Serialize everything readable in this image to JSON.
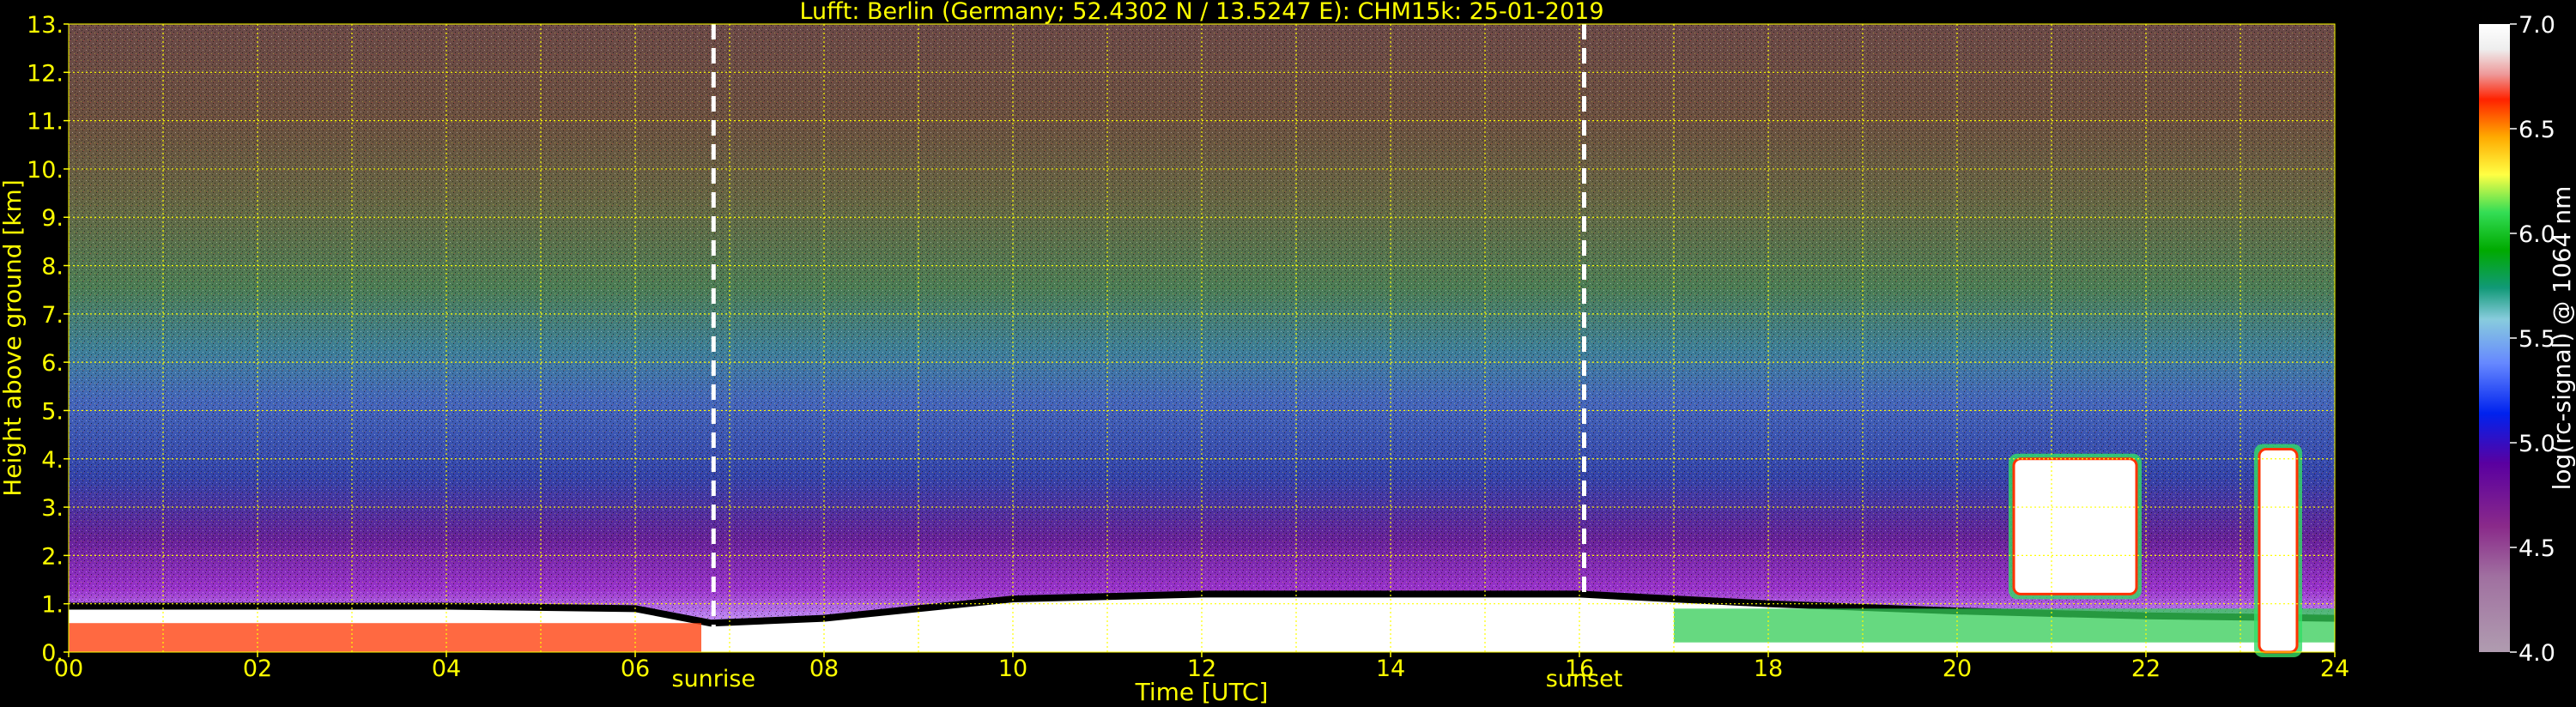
{
  "chart_data": {
    "type": "heatmap",
    "title": "Lufft: Berlin (Germany; 52.4302 N / 13.5247 E):    CHM15k: 25-01-2019",
    "xlabel": "Time [UTC]",
    "ylabel": "Height above ground [km]",
    "xlim": [
      0,
      24
    ],
    "ylim": [
      0,
      13
    ],
    "x_ticks": [
      "00",
      "02",
      "04",
      "06",
      "08",
      "10",
      "12",
      "14",
      "16",
      "18",
      "20",
      "22",
      "24"
    ],
    "y_ticks": [
      "0.",
      "1.",
      "2.",
      "3.",
      "4.",
      "5.",
      "6.",
      "7.",
      "8.",
      "9.",
      "10.",
      "11.",
      "12.",
      "13."
    ],
    "grid": true,
    "markers": [
      {
        "label": "sunrise",
        "x": 6.83
      },
      {
        "label": "sunset",
        "x": 16.05
      }
    ],
    "colorbar": {
      "label": "log(rc-signal) @ 1064 nm",
      "range": [
        4.0,
        7.0
      ],
      "ticks": [
        "4.0",
        "4.5",
        "5.0",
        "5.5",
        "6.0",
        "6.5",
        "7.0"
      ]
    },
    "features": [
      {
        "name": "boundary layer top",
        "x": [
          0,
          2,
          4,
          6,
          6.8,
          8,
          10,
          12,
          14,
          16,
          18,
          20,
          22,
          24
        ],
        "y": [
          0.95,
          0.95,
          0.95,
          0.9,
          0.6,
          0.7,
          1.1,
          1.2,
          1.2,
          1.2,
          1.0,
          0.85,
          0.75,
          0.7
        ]
      },
      {
        "name": "cloud layer",
        "x_range": [
          20.6,
          21.9
        ],
        "y_range": [
          1.2,
          4.0
        ]
      },
      {
        "name": "cloud layer",
        "x_range": [
          23.2,
          23.6
        ],
        "y_range": [
          0.0,
          4.2
        ]
      }
    ]
  }
}
